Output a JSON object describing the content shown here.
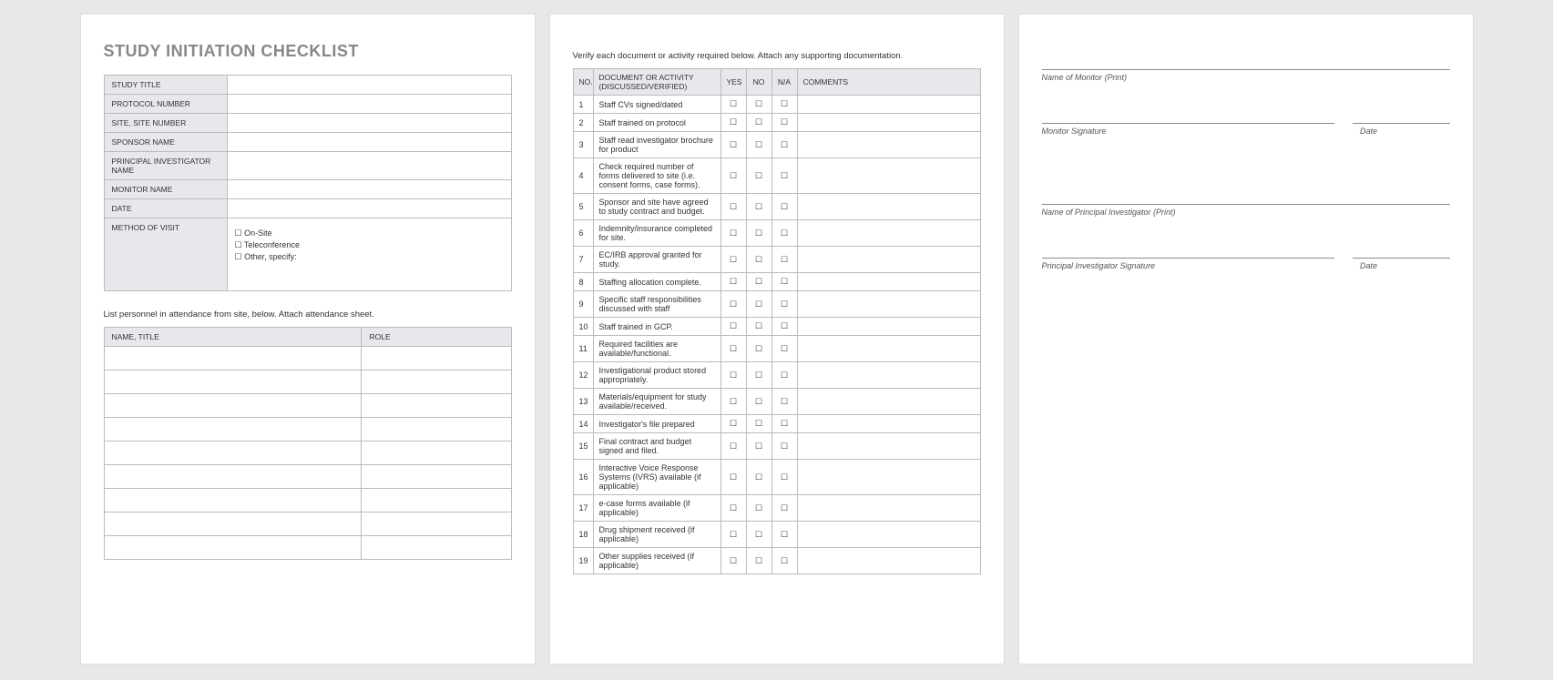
{
  "page1": {
    "title": "STUDY INITIATION CHECKLIST",
    "infoRows": [
      {
        "label": "STUDY TITLE"
      },
      {
        "label": "PROTOCOL NUMBER"
      },
      {
        "label": "SITE, SITE NUMBER"
      },
      {
        "label": "SPONSOR NAME"
      },
      {
        "label": "PRINCIPAL INVESTIGATOR NAME"
      },
      {
        "label": "MONITOR NAME"
      },
      {
        "label": "DATE"
      }
    ],
    "methodLabel": "METHOD OF VISIT",
    "methodOptions": [
      "☐ On-Site",
      "☐ Teleconference",
      "☐ Other, specify:"
    ],
    "personnelInstruction": "List personnel in attendance from site, below. Attach attendance sheet.",
    "personnelHeaders": {
      "name": "NAME, TITLE",
      "role": "ROLE"
    },
    "personnelRowCount": 9
  },
  "page2": {
    "instruction": "Verify each document or activity required below. Attach any supporting documentation.",
    "headers": {
      "no": "NO.",
      "doc": "DOCUMENT OR ACTIVITY (DISCUSSED/VERIFIED)",
      "yes": "YES",
      "no_col": "NO",
      "na": "N/A",
      "comments": "COMMENTS"
    },
    "items": [
      {
        "no": "1",
        "text": "Staff CVs signed/dated"
      },
      {
        "no": "2",
        "text": "Staff trained on protocol"
      },
      {
        "no": "3",
        "text": "Staff read investigator brochure for product"
      },
      {
        "no": "4",
        "text": "Check required number of forms delivered to site (i.e. consent forms, case forms)."
      },
      {
        "no": "5",
        "text": "Sponsor and site have agreed to study contract and budget."
      },
      {
        "no": "6",
        "text": "Indemnity/insurance completed for site."
      },
      {
        "no": "7",
        "text": "EC/IRB approval granted for study."
      },
      {
        "no": "8",
        "text": "Staffing allocation complete."
      },
      {
        "no": "9",
        "text": "Specific staff responsibilities discussed with staff"
      },
      {
        "no": "10",
        "text": "Staff trained in GCP."
      },
      {
        "no": "11",
        "text": "Required facilities are available/functional."
      },
      {
        "no": "12",
        "text": "Investigational product stored appropriately."
      },
      {
        "no": "13",
        "text": "Materials/equipment for study available/received."
      },
      {
        "no": "14",
        "text": "Investigator's file prepared"
      },
      {
        "no": "15",
        "text": "Final contract and budget signed and filed."
      },
      {
        "no": "16",
        "text": "Interactive Voice Response Systems (IVRS) available (if applicable)"
      },
      {
        "no": "17",
        "text": "e-case forms available (if applicable)"
      },
      {
        "no": "18",
        "text": "Drug shipment received (if applicable)"
      },
      {
        "no": "19",
        "text": "Other supplies received (if applicable)"
      }
    ],
    "checkbox": "☐"
  },
  "page3": {
    "monitorNameLabel": "Name of Monitor (Print)",
    "monitorSigLabel": "Monitor Signature",
    "dateLabel": "Date",
    "piNameLabel": "Name of Principal Investigator (Print)",
    "piSigLabel": "Principal Investigator Signature"
  }
}
